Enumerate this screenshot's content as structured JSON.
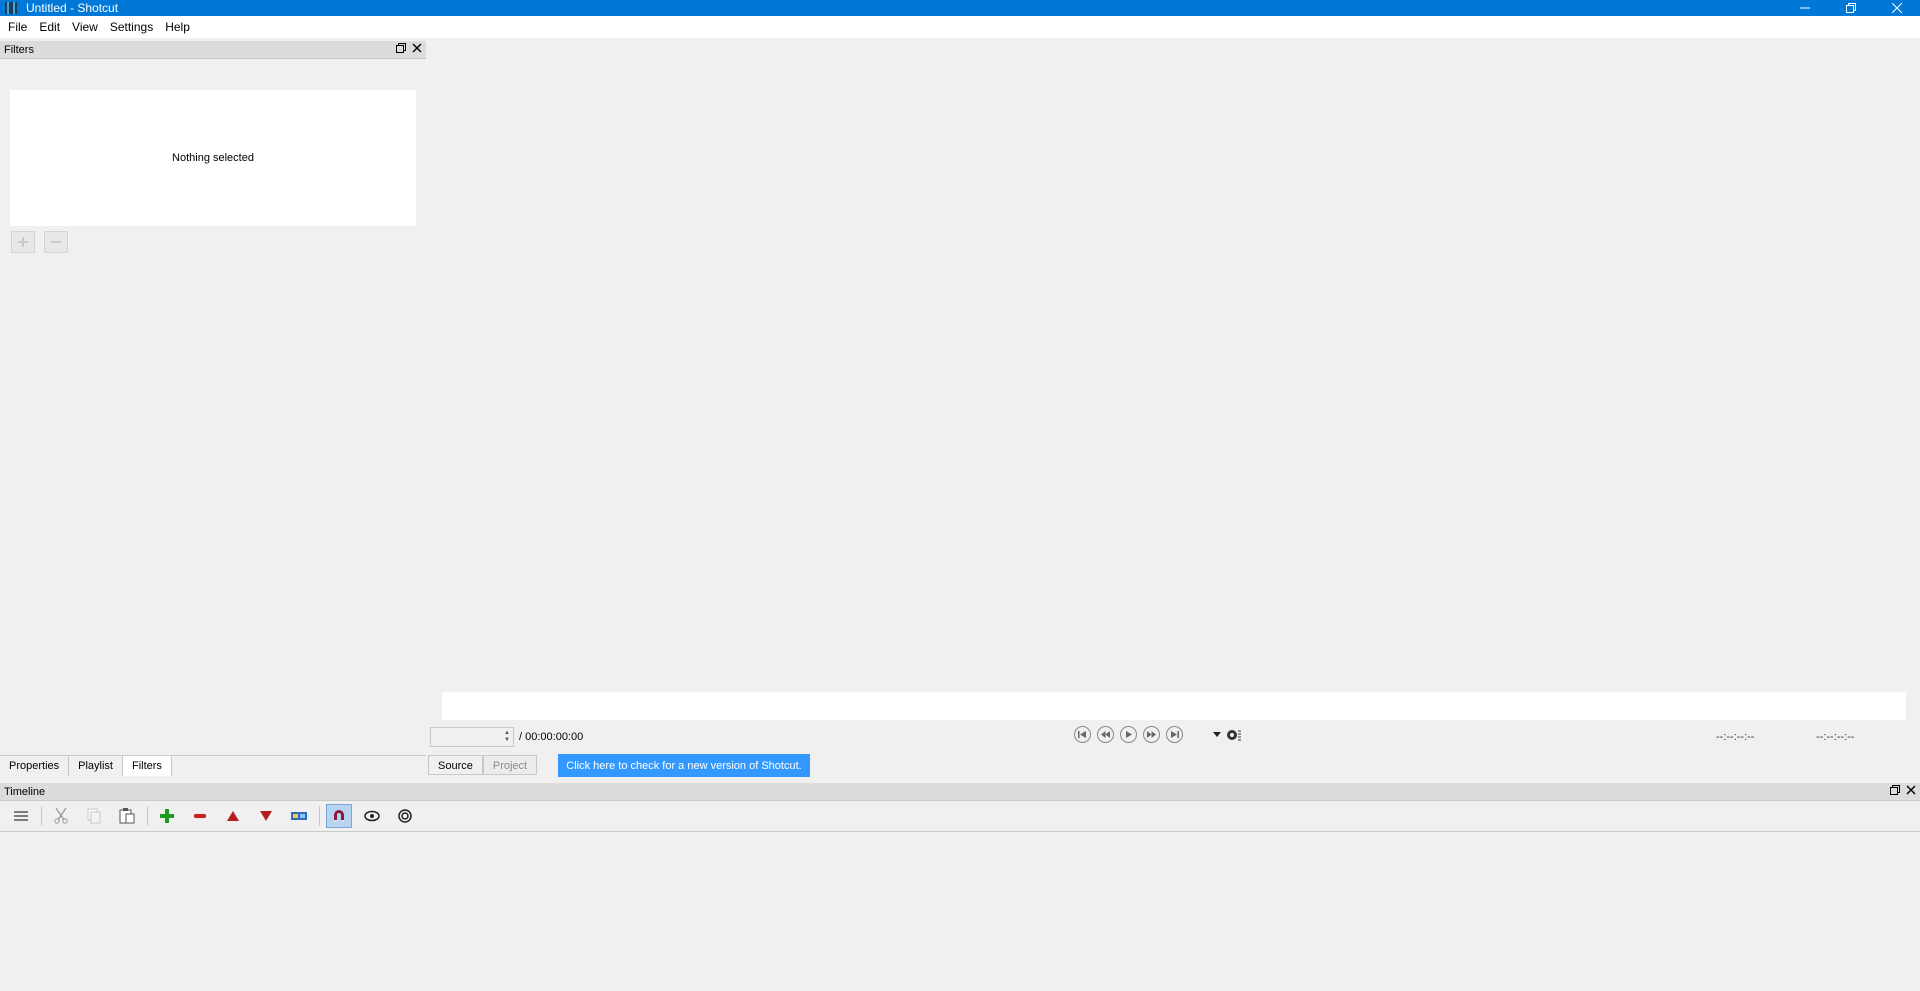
{
  "window": {
    "title": "Untitled - Shotcut"
  },
  "menu": {
    "items": [
      "File",
      "Edit",
      "View",
      "Settings",
      "Help"
    ]
  },
  "filters_panel": {
    "title": "Filters",
    "empty_text": "Nothing selected"
  },
  "left_tabs": [
    "Properties",
    "Playlist",
    "Filters"
  ],
  "player": {
    "timecode_value": "",
    "duration": "/ 00:00:00:00",
    "in_point": "--:--:--:--",
    "out_point": "--:--:--:--"
  },
  "source_tabs": [
    "Source",
    "Project"
  ],
  "update_button": "Click here to check for a new version of Shotcut.",
  "timeline": {
    "title": "Timeline"
  },
  "colors": {
    "titlebar": "#0078d7",
    "update_button": "#3399ff",
    "add_green": "#1e9b1e",
    "remove_red": "#cc1f1f",
    "snap_active": "#b7d3f2"
  }
}
